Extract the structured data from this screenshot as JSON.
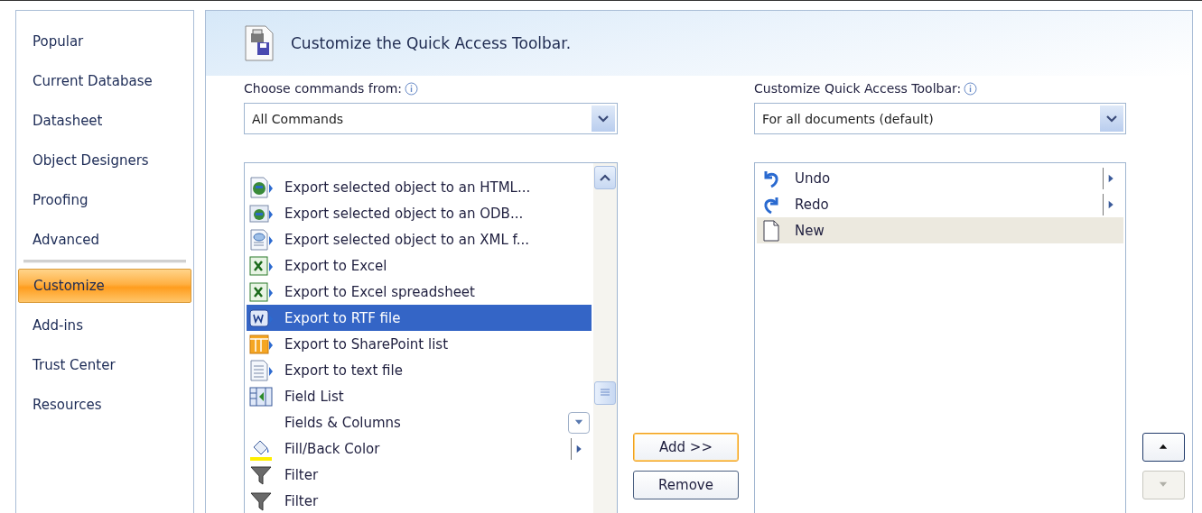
{
  "sidebar": {
    "items": [
      {
        "label": "Popular",
        "selected": false
      },
      {
        "label": "Current Database",
        "selected": false
      },
      {
        "label": "Datasheet",
        "selected": false
      },
      {
        "label": "Object Designers",
        "selected": false
      },
      {
        "label": "Proofing",
        "selected": false
      },
      {
        "label": "Advanced",
        "selected": false
      },
      {
        "label": "Customize",
        "selected": true
      },
      {
        "label": "Add-ins",
        "selected": false
      },
      {
        "label": "Trust Center",
        "selected": false
      },
      {
        "label": "Resources",
        "selected": false
      }
    ]
  },
  "header": {
    "title": "Customize the Quick Access Toolbar."
  },
  "commands": {
    "label": "Choose commands from:",
    "dropdown": {
      "value": "All Commands"
    },
    "items": [
      {
        "label": "Export selected object to an HTML...",
        "kind": "plain",
        "selected": false
      },
      {
        "label": "Export selected object to an ODB...",
        "kind": "plain",
        "selected": false
      },
      {
        "label": "Export selected object to an XML f...",
        "kind": "plain",
        "selected": false
      },
      {
        "label": "Export to Excel",
        "kind": "plain",
        "selected": false
      },
      {
        "label": "Export to Excel spreadsheet",
        "kind": "plain",
        "selected": false
      },
      {
        "label": "Export to RTF file",
        "kind": "plain",
        "selected": true
      },
      {
        "label": "Export to SharePoint list",
        "kind": "plain",
        "selected": false
      },
      {
        "label": "Export to text file",
        "kind": "plain",
        "selected": false
      },
      {
        "label": "Field List",
        "kind": "plain",
        "selected": false
      },
      {
        "label": "Fields & Columns",
        "kind": "dropdown",
        "selected": false
      },
      {
        "label": "Fill/Back Color",
        "kind": "submenu",
        "selected": false
      },
      {
        "label": "Filter",
        "kind": "plain",
        "selected": false
      },
      {
        "label": "Filter",
        "kind": "plain",
        "selected": false
      }
    ]
  },
  "toolbar": {
    "label": "Customize Quick Access Toolbar:",
    "dropdown": {
      "value": "For all documents (default)"
    },
    "items": [
      {
        "label": "Undo",
        "kind": "submenu",
        "selected": false
      },
      {
        "label": "Redo",
        "kind": "submenu",
        "selected": false
      },
      {
        "label": "New",
        "kind": "plain",
        "selected": true
      }
    ]
  },
  "buttons": [
    {
      "label": "Add >>",
      "default": true
    },
    {
      "label": "Remove",
      "default": false
    }
  ],
  "move_buttons": [
    {
      "disabled": false
    },
    {
      "disabled": true
    }
  ]
}
